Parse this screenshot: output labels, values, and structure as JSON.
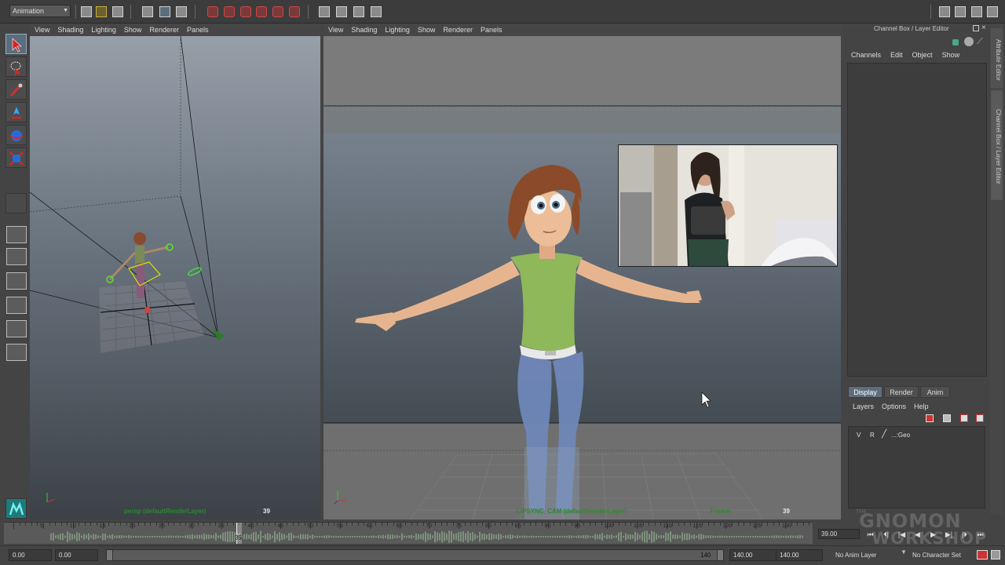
{
  "status_line": {
    "menu_set": "Animation"
  },
  "viewport_menu": [
    "View",
    "Shading",
    "Lighting",
    "Show",
    "Renderer",
    "Panels"
  ],
  "left_viewport": {
    "hud_camera": "persp (defaultRenderLayer)",
    "hud_frame": "39"
  },
  "main_viewport": {
    "hud_camera": "LIPSYNC_CAM (defaultRenderLayer)",
    "hud_frame_label": "Frame:",
    "hud_frame": "39"
  },
  "channel_box": {
    "title": "Channel Box / Layer Editor",
    "menu": [
      "Channels",
      "Edit",
      "Object",
      "Show"
    ]
  },
  "side_tabs": [
    "Attribute Editor",
    "Channel Box / Layer Editor"
  ],
  "layer_editor": {
    "tabs": [
      "Display",
      "Render",
      "Anim"
    ],
    "active_tab": "Display",
    "menu": [
      "Layers",
      "Options",
      "Help"
    ],
    "layers": [
      {
        "visible": "V",
        "reference": "R",
        "name": "...:Geo"
      }
    ]
  },
  "time_slider": {
    "ticks": [
      "5",
      "10",
      "15",
      "20",
      "25",
      "30",
      "35",
      "40",
      "45",
      "50",
      "55",
      "60",
      "65",
      "70",
      "75",
      "80",
      "85",
      "90",
      "95",
      "100",
      "105",
      "110",
      "115",
      "120",
      "125",
      "130",
      "135"
    ],
    "current_frame": "39",
    "current_time": "39.00"
  },
  "playback_controls": [
    "⏮",
    "⏴|",
    "|◀",
    "◀",
    "▶",
    "▶|",
    "|⏵",
    "⏭"
  ],
  "range_slider": {
    "start_time": "0.00",
    "playback_start": "0.00",
    "range_start_label": "0",
    "range_end_label": "140",
    "playback_end": "140.00",
    "end_time": "140.00"
  },
  "anim_layer": "No Anim Layer",
  "character_set": "No Character Set",
  "watermark": {
    "line1": "THE",
    "line2": "GNOMON",
    "line3": "WORKSHOP"
  },
  "colors": {
    "hud_green": "#2b8a2b",
    "active_tab": "#5e6e7e",
    "viewport_top": "#9aa2ab",
    "viewport_bottom": "#3c4148"
  }
}
